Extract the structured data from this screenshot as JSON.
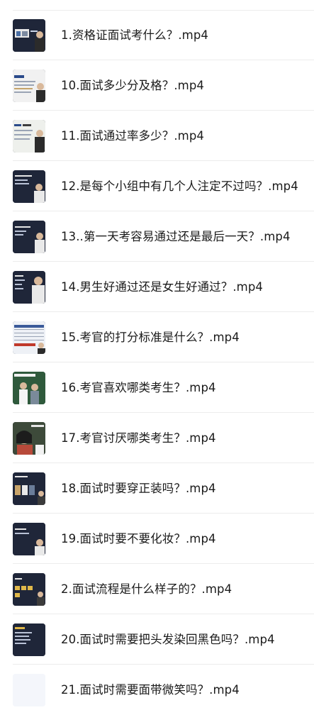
{
  "files": [
    {
      "name": "1.资格证面试考什么？.mp4",
      "thumb_icon": "video-thumbnail-icon"
    },
    {
      "name": "10.面试多少分及格？.mp4",
      "thumb_icon": "video-thumbnail-icon"
    },
    {
      "name": "11.面试通过率多少？.mp4",
      "thumb_icon": "video-thumbnail-icon"
    },
    {
      "name": "12.是每个小组中有几个人注定不过吗？.mp4",
      "thumb_icon": "video-thumbnail-icon"
    },
    {
      "name": "13..第一天考容易通过还是最后一天？.mp4",
      "thumb_icon": "video-thumbnail-icon"
    },
    {
      "name": "14.男生好通过还是女生好通过？.mp4",
      "thumb_icon": "video-thumbnail-icon"
    },
    {
      "name": "15.考官的打分标准是什么？.mp4",
      "thumb_icon": "video-thumbnail-icon"
    },
    {
      "name": "16.考官喜欢哪类考生？.mp4",
      "thumb_icon": "video-thumbnail-icon"
    },
    {
      "name": "17.考官讨厌哪类考生？.mp4",
      "thumb_icon": "video-thumbnail-icon"
    },
    {
      "name": "18.面试时要穿正装吗？.mp4",
      "thumb_icon": "video-thumbnail-icon"
    },
    {
      "name": "19.面试时要不要化妆？.mp4",
      "thumb_icon": "video-thumbnail-icon"
    },
    {
      "name": "2.面试流程是什么样子的？.mp4",
      "thumb_icon": "video-thumbnail-icon"
    },
    {
      "name": "20.面试时需要把头发染回黑色吗？.mp4",
      "thumb_icon": "video-thumbnail-icon"
    },
    {
      "name": "21.面试时需要面带微笑吗？.mp4",
      "thumb_icon": "video-thumbnail-placeholder-icon"
    }
  ],
  "colors": {
    "text": "#1a1a1a",
    "divider": "#ececec",
    "thumb_dark": "#1f2639",
    "thumb_placeholder": "#f4f6fb"
  }
}
